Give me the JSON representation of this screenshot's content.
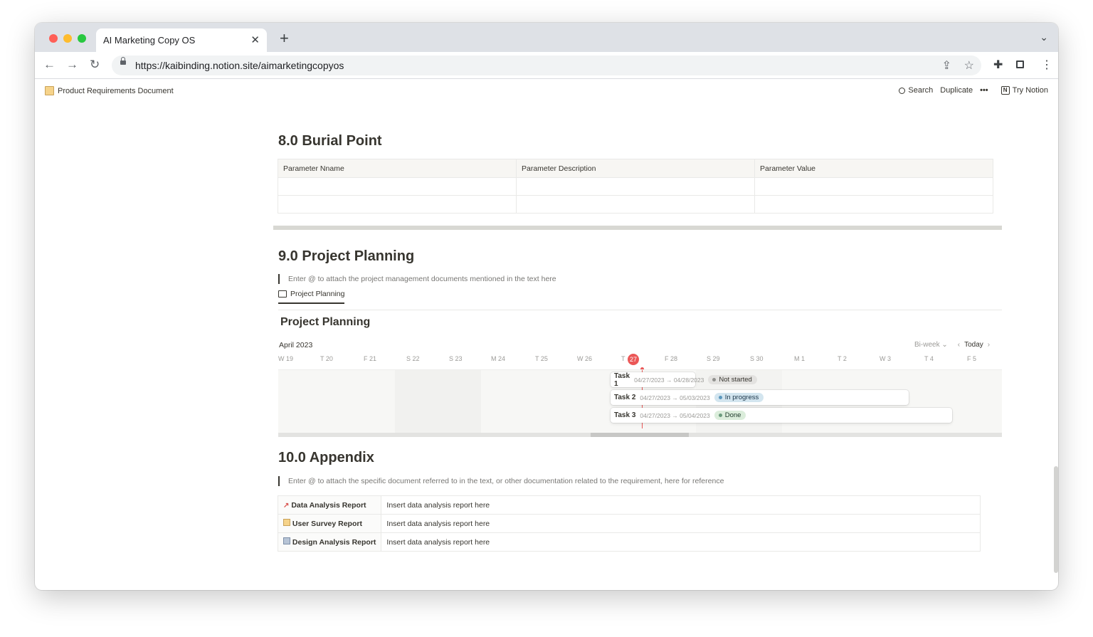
{
  "browser": {
    "tab_title": "AI Marketing Copy OS",
    "url": "https://kaibinding.notion.site/aimarketingcopyos",
    "traffic_lights": [
      "#ff5f57",
      "#febc2e",
      "#28c840"
    ]
  },
  "notion_bar": {
    "breadcrumb": "Product Requirements Document",
    "search": "Search",
    "duplicate": "Duplicate",
    "more": "•••",
    "try_notion": "Try Notion"
  },
  "burial": {
    "heading": "8.0 Burial Point",
    "columns": [
      "Parameter Nname",
      "Parameter Description",
      "Parameter Value"
    ]
  },
  "planning": {
    "heading": "9.0 Project Planning",
    "quote": "Enter @ to attach the project management documents mentioned in the text here",
    "view_tab": "Project Planning",
    "db_title": "Project Planning",
    "month": "April 2023",
    "range": "Bi-week",
    "today": "Today",
    "days": [
      "W 19",
      "T 20",
      "F 21",
      "S 22",
      "S 23",
      "M 24",
      "T 25",
      "W 26",
      "T",
      "F 28",
      "S 29",
      "S 30",
      "M 1",
      "T 2",
      "W 3",
      "T 4",
      "F 5"
    ],
    "today_num": "27",
    "tasks": [
      {
        "name": "Task 1",
        "dates": "04/27/2023 → 04/28/2023",
        "status": "Not started",
        "status_bg": "#e3e2e0",
        "status_dot": "#91918e"
      },
      {
        "name": "Task 2",
        "dates": "04/27/2023 → 05/03/2023",
        "status": "In progress",
        "status_bg": "#d3e5ef",
        "status_dot": "#5b97bd"
      },
      {
        "name": "Task 3",
        "dates": "04/27/2023 → 05/04/2023",
        "status": "Done",
        "status_bg": "#dbeddb",
        "status_dot": "#6c9b7d"
      }
    ]
  },
  "appendix": {
    "heading": "10.0 Appendix",
    "quote": "Enter @ to attach the specific document referred to in the text, or other documentation related to the requirement, here for reference",
    "rows": [
      {
        "icon": "chart-increasing-icon",
        "name": "Data Analysis Report",
        "value": "Insert data analysis report here"
      },
      {
        "icon": "memo-icon",
        "name": "User Survey Report",
        "value": "Insert data analysis report here"
      },
      {
        "icon": "card-index-icon",
        "name": "Design Analysis Report",
        "value": "Insert data analysis report here"
      }
    ]
  }
}
